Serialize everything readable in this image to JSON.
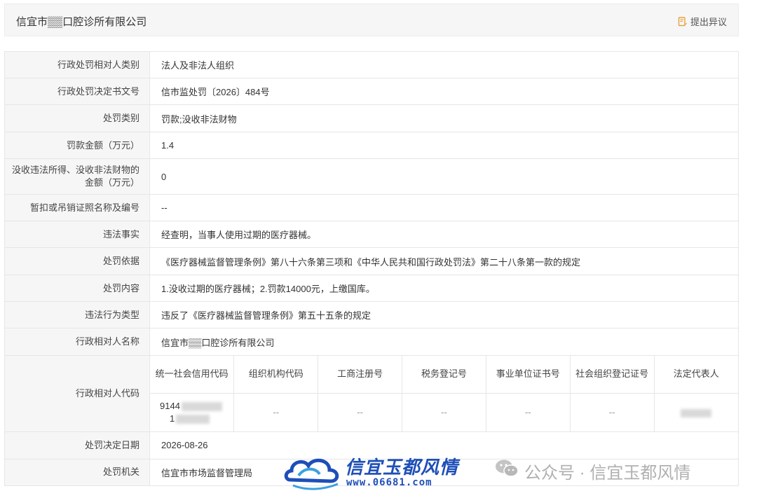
{
  "header": {
    "company_name": "信宜市▒▒口腔诊所有限公司",
    "objection_label": "提出异议",
    "objection_icon": "edit-doc-icon"
  },
  "rows": [
    {
      "label": "行政处罚相对人类别",
      "value": "法人及非法人组织"
    },
    {
      "label": "行政处罚决定书文号",
      "value": "信市监处罚〔2026〕484号"
    },
    {
      "label": "处罚类别",
      "value": "罚款;没收非法财物"
    },
    {
      "label": "罚款金额（万元）",
      "value": "1.4"
    },
    {
      "label": "没收违法所得、没收非法财物的金额（万元）",
      "value": "0"
    },
    {
      "label": "暂扣或吊销证照名称及编号",
      "value": "--"
    },
    {
      "label": "违法事实",
      "value": "经查明，当事人使用过期的医疗器械。"
    },
    {
      "label": "处罚依据",
      "value": "《医疗器械监督管理条例》第八十六条第三项和《中华人民共和国行政处罚法》第二十八条第一款的规定"
    },
    {
      "label": "处罚内容",
      "value": "1.没收过期的医疗器械；2.罚款14000元，上缴国库。"
    },
    {
      "label": "违法行为类型",
      "value": "违反了《医疗器械监督管理条例》第五十五条的规定"
    },
    {
      "label": "行政相对人名称",
      "value": "信宜市▒▒口腔诊所有限公司"
    }
  ],
  "code_section": {
    "label": "行政相对人代码",
    "columns": [
      "统一社会信用代码",
      "组织机构代码",
      "工商注册号",
      "税务登记号",
      "事业单位证书号",
      "社会组织登记证号",
      "法定代表人"
    ],
    "values": [
      "9144",
      "--",
      "--",
      "--",
      "--",
      "--",
      ""
    ],
    "credit_code_line2": "1"
  },
  "bottom_rows": [
    {
      "label": "处罚决定日期",
      "value": "2026-08-26"
    },
    {
      "label": "处罚机关",
      "value": "信宜市市场监督管理局"
    }
  ],
  "watermark": {
    "brand": "信宜玉都风情",
    "url": "www.06681.com",
    "wechat_text": "公众号 · 信宜玉都风情"
  }
}
